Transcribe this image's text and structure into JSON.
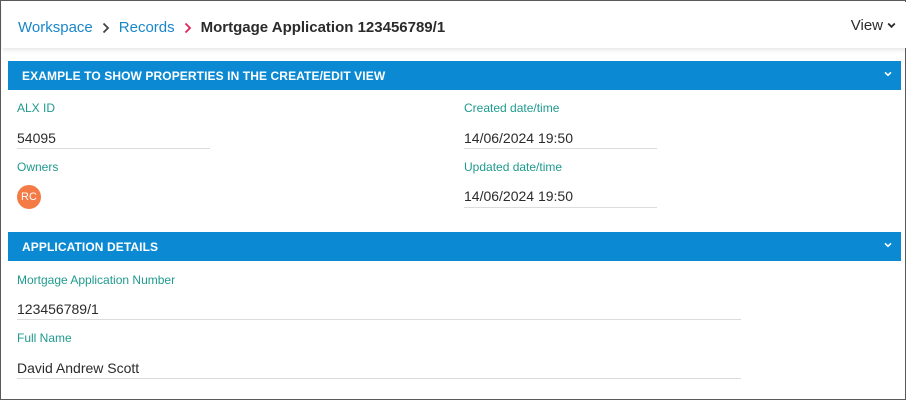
{
  "breadcrumb": {
    "items": [
      "Workspace",
      "Records"
    ],
    "current": "Mortgage Application 123456789/1"
  },
  "header": {
    "view_label": "View"
  },
  "section_properties": {
    "title": "EXAMPLE TO SHOW PROPERTIES IN THE CREATE/EDIT VIEW",
    "fields": {
      "alx_id": {
        "label": "ALX ID",
        "value": "54095"
      },
      "created": {
        "label": "Created date/time",
        "value": "14/06/2024 19:50"
      },
      "owners": {
        "label": "Owners",
        "avatar_initials": "RC"
      },
      "updated": {
        "label": "Updated date/time",
        "value": "14/06/2024 19:50"
      }
    }
  },
  "section_application": {
    "title": "APPLICATION DETAILS",
    "fields": {
      "mortgage_number": {
        "label": "Mortgage Application Number",
        "value": "123456789/1"
      },
      "full_name": {
        "label": "Full Name",
        "value": "David Andrew Scott"
      }
    }
  },
  "colors": {
    "accent_blue": "#0b8ad3",
    "link_blue": "#1a87c9",
    "label_teal": "#1f9a8e",
    "avatar_orange": "#f47b45",
    "breadcrumb_separator_active": "#e0245e"
  }
}
